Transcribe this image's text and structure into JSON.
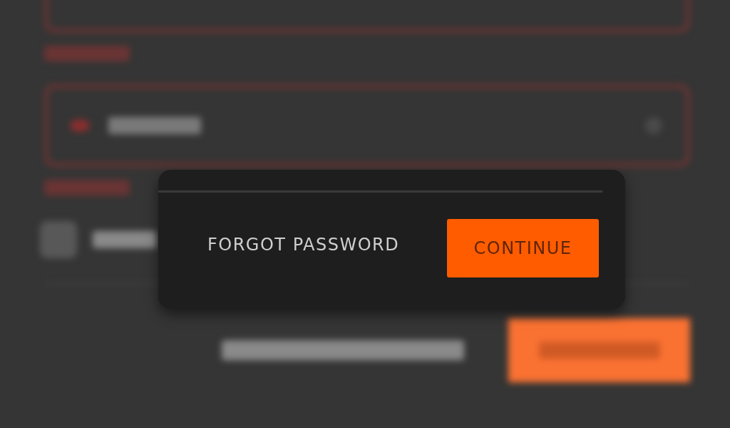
{
  "background_form": {
    "fields": [
      {
        "kind": "text",
        "error": true
      },
      {
        "kind": "password",
        "error": true
      }
    ],
    "remember": {
      "checked": false
    }
  },
  "dialog": {
    "forgot_link": "FORGOT PASSWORD",
    "continue_button": "CONTINUE"
  }
}
